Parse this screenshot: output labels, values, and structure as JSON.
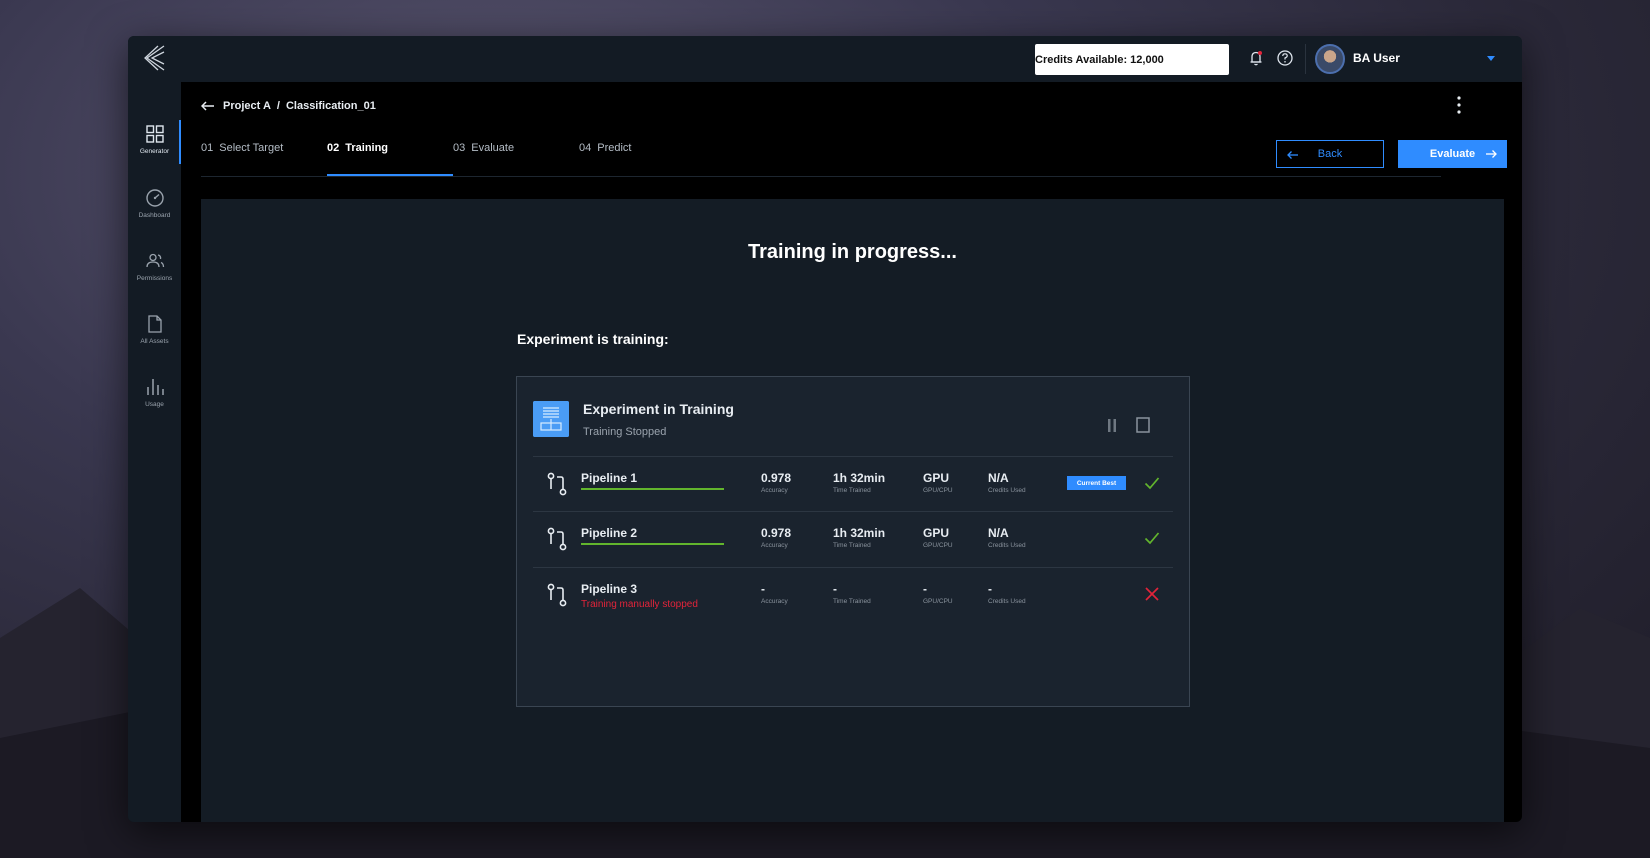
{
  "topbar": {
    "credits_label": "Credits Available: 12,000",
    "user_name": "BA User"
  },
  "sidebar": {
    "items": [
      {
        "label": "Generator",
        "icon": "grid-icon",
        "active": true
      },
      {
        "label": "Dashboard",
        "icon": "gauge-icon",
        "active": false
      },
      {
        "label": "Permissions",
        "icon": "users-icon",
        "active": false
      },
      {
        "label": "All Assets",
        "icon": "file-icon",
        "active": false
      },
      {
        "label": "Usage",
        "icon": "bar-chart-icon",
        "active": false
      }
    ]
  },
  "breadcrumb": {
    "project": "Project A",
    "separator": "/",
    "page": "Classification_01"
  },
  "tabs": [
    {
      "num": "01",
      "label": "Select Target"
    },
    {
      "num": "02",
      "label": "Training"
    },
    {
      "num": "03",
      "label": "Evaluate"
    },
    {
      "num": "04",
      "label": "Predict"
    }
  ],
  "buttons": {
    "back": "Back",
    "evaluate": "Evaluate"
  },
  "main": {
    "headline": "Training in progress...",
    "subheading": "Experiment is training:"
  },
  "experiment": {
    "title": "Experiment in Training",
    "status": "Training Stopped",
    "metric_labels": {
      "accuracy": "Accuracy",
      "time": "Time Trained",
      "hardware": "GPU/CPU",
      "credits": "Credits Used"
    },
    "pipelines": [
      {
        "name": "Pipeline 1",
        "accuracy": "0.978",
        "time": "1h 32min",
        "hardware": "GPU",
        "credits": "N/A",
        "badge": "Current Best",
        "status": "success"
      },
      {
        "name": "Pipeline 2",
        "accuracy": "0.978",
        "time": "1h 32min",
        "hardware": "GPU",
        "credits": "N/A",
        "badge": "",
        "status": "success"
      },
      {
        "name": "Pipeline 3",
        "note": "Training manually stopped",
        "accuracy": "-",
        "time": "-",
        "hardware": "-",
        "credits": "-",
        "badge": "",
        "status": "failed"
      }
    ]
  },
  "colors": {
    "accent": "#2f8cff",
    "success": "#62b52d",
    "error": "#e2243a"
  }
}
